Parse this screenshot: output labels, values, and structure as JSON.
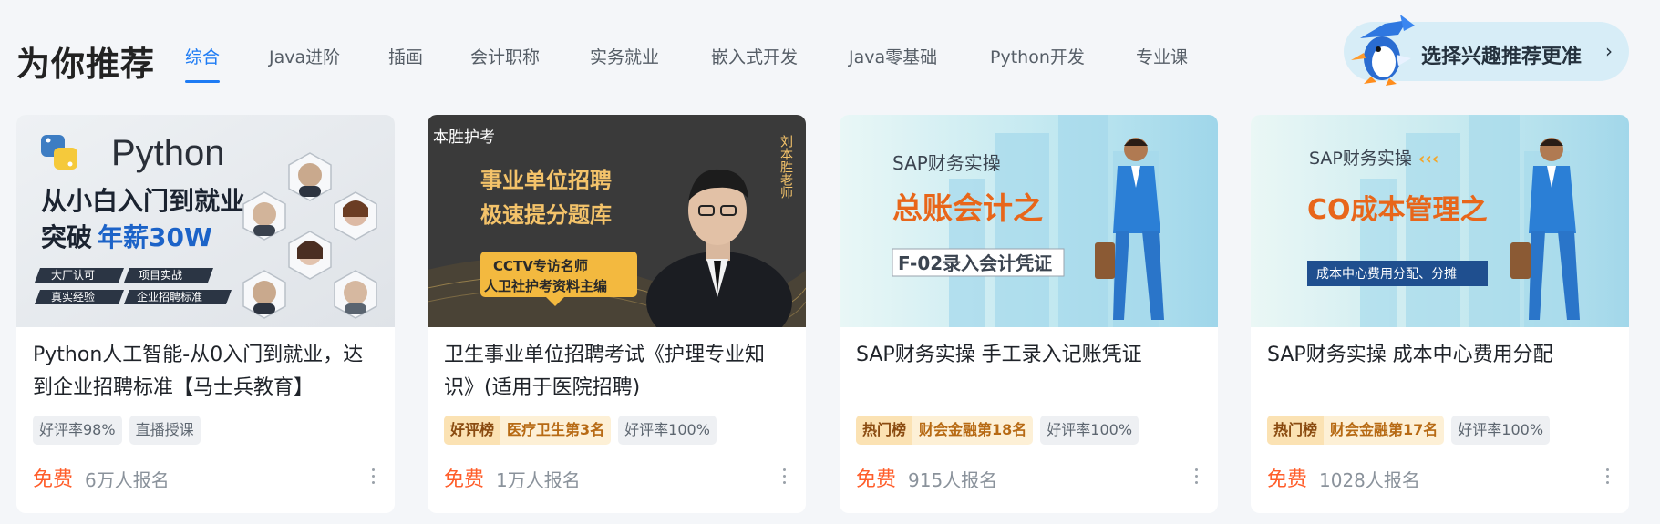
{
  "section": {
    "title": "为你推荐",
    "tabs": [
      "综合",
      "Java进阶",
      "插画",
      "会计职称",
      "实务就业",
      "嵌入式开发",
      "Java零基础",
      "Python开发",
      "专业课"
    ],
    "active_tab": 0
  },
  "interest": {
    "label": "选择兴趣推荐更准",
    "chevron": "›",
    "mascot_icon": "penguin-mascot-icon"
  },
  "cards": [
    {
      "title": "Python人工智能-从0入门到就业，达到企业招聘标准【马士兵教育】",
      "badges": [
        "好评率98%",
        "直播授课"
      ],
      "rank": null,
      "price": "免费",
      "enroll": "6万人报名",
      "thumb": {
        "brand": "Python",
        "line1": "从小白入门到就业",
        "line2_prefix": "突破",
        "line2_highlight": "年薪30W",
        "chips": [
          "大厂认可",
          "项目实战",
          "真实经验",
          "企业招聘标准"
        ]
      }
    },
    {
      "title": "卫生事业单位招聘考试《护理专业知识》(适用于医院招聘)",
      "badges": [
        "好评率100%"
      ],
      "rank": {
        "tag": "好评榜",
        "text": "医疗卫生第3名"
      },
      "price": "免费",
      "enroll": "1万人报名",
      "thumb": {
        "logo": "本胜护考",
        "line1": "事业单位招聘",
        "line2": "极速提分题库",
        "box1": "CCTV专访名师",
        "box2": "人卫社护考资料主编",
        "teacher": "刘本胜老师"
      }
    },
    {
      "title": "SAP财务实操 手工录入记账凭证",
      "badges": [
        "好评率100%"
      ],
      "rank": {
        "tag": "热门榜",
        "text": "财会金融第18名"
      },
      "price": "免费",
      "enroll": "915人报名",
      "thumb": {
        "kicker": "SAP财务实操",
        "headline": "总账会计之",
        "sub": "F-02录入会计凭证"
      }
    },
    {
      "title": "SAP财务实操 成本中心费用分配",
      "badges": [
        "好评率100%"
      ],
      "rank": {
        "tag": "热门榜",
        "text": "财会金融第17名"
      },
      "price": "免费",
      "enroll": "1028人报名",
      "thumb": {
        "kicker": "SAP财务实操",
        "headline": "CO成本管理之",
        "sub": "成本中心费用分配、分摊"
      }
    }
  ]
}
